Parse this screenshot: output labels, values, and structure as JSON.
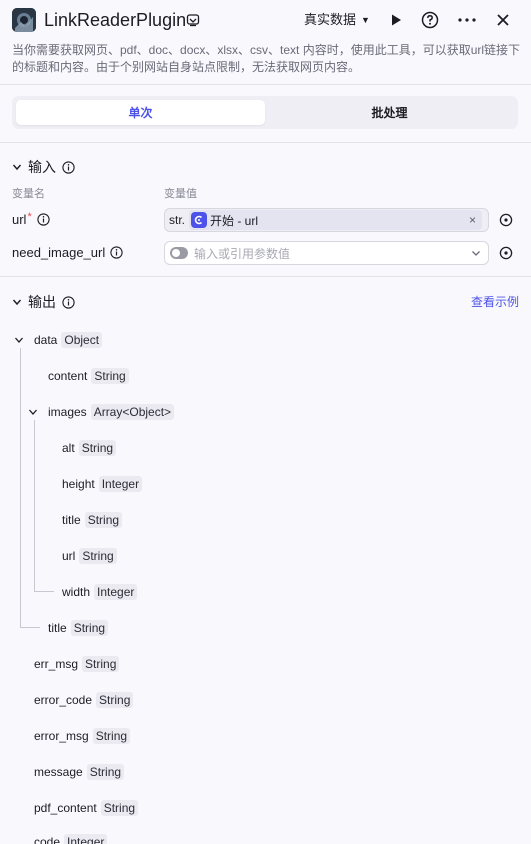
{
  "header": {
    "title": "LinkReaderPlugin",
    "mode": "真实数据",
    "description": "当你需要获取网页、pdf、doc、docx、xlsx、csv、text 内容时，使用此工具，可以获取url链接下的标题和内容。由于个别网站自身站点限制，无法获取网页内容。"
  },
  "tabs": [
    {
      "label": "单次",
      "active": true
    },
    {
      "label": "批处理",
      "active": false
    }
  ],
  "input": {
    "title": "输入",
    "col_name": "变量名",
    "col_value": "变量值",
    "params": [
      {
        "name": "url",
        "required": true,
        "type_tag": "str.",
        "ref_label": "开始 - url"
      },
      {
        "name": "need_image_url",
        "required": false,
        "placeholder": "输入或引用参数值"
      }
    ]
  },
  "output": {
    "title": "输出",
    "view_example": "查看示例",
    "tree": [
      {
        "name": "data",
        "type": "Object"
      },
      {
        "name": "content",
        "type": "String"
      },
      {
        "name": "images",
        "type": "Array<Object>"
      },
      {
        "name": "alt",
        "type": "String"
      },
      {
        "name": "height",
        "type": "Integer"
      },
      {
        "name": "title",
        "type": "String"
      },
      {
        "name": "url",
        "type": "String"
      },
      {
        "name": "width",
        "type": "Integer"
      },
      {
        "name": "title",
        "type": "String"
      },
      {
        "name": "err_msg",
        "type": "String"
      },
      {
        "name": "error_code",
        "type": "String"
      },
      {
        "name": "error_msg",
        "type": "String"
      },
      {
        "name": "message",
        "type": "String"
      },
      {
        "name": "pdf_content",
        "type": "String"
      },
      {
        "name": "code",
        "type": "Integer"
      }
    ]
  },
  "colors": {
    "accent": "#4d53e8",
    "required": "#e5484d",
    "background": "#f9f8fd"
  }
}
